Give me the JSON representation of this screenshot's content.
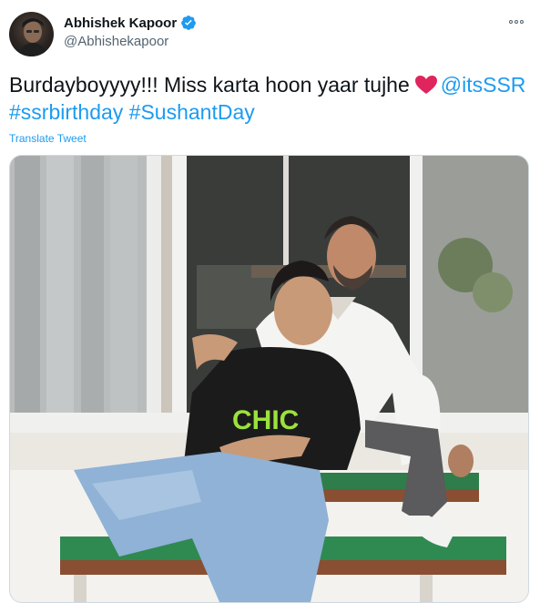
{
  "author": {
    "display_name": "Abhishek Kapoor",
    "handle": "@Abhishekapoor",
    "verified_icon": "verified-badge-icon"
  },
  "tweet": {
    "text_intro": "Burdayboyyyy!!! Miss karta hoon yaar tujhe",
    "mention": "@itsSSR",
    "hashtag1": "#ssrbirthday",
    "hashtag2": "#SushantDay",
    "translate_label": "Translate Tweet"
  },
  "photo": {
    "shirt_text": "CHIC"
  },
  "colors": {
    "link": "#1d9bf0",
    "text": "#0f1419",
    "secondary": "#536471",
    "heart": "#e0245e"
  }
}
